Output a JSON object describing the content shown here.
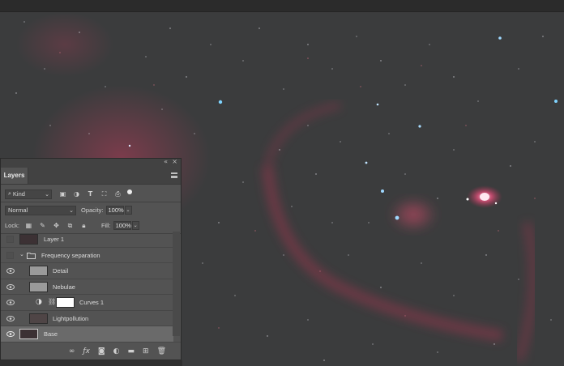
{
  "panel": {
    "collapse_glyph": "«",
    "close_glyph": "×",
    "tab_label": "Layers"
  },
  "filter": {
    "kind_label": "Kind",
    "icons": [
      "image-filter-icon",
      "adjustment-filter-icon",
      "type-filter-icon",
      "shape-filter-icon",
      "smart-object-filter-icon"
    ]
  },
  "blend": {
    "mode": "Normal",
    "opacity_label": "Opacity:",
    "opacity_value": "100%"
  },
  "lock": {
    "label": "Lock:",
    "fill_label": "Fill:",
    "fill_value": "100%"
  },
  "layers": [
    {
      "name": "Layer 1",
      "visible": false,
      "thumb": "stars"
    },
    {
      "name": "Frequency separation",
      "visible": false,
      "thumb": "folder"
    },
    {
      "name": "Detail",
      "visible": true,
      "thumb": "gray"
    },
    {
      "name": "Nebulae",
      "visible": true,
      "thumb": "gray"
    },
    {
      "name": "Curves 1",
      "visible": true,
      "thumb": "white"
    },
    {
      "name": "Lightpollution",
      "visible": true,
      "thumb": "dark"
    },
    {
      "name": "Base",
      "visible": true,
      "thumb": "stars",
      "selected": true
    }
  ],
  "colors": {
    "panel_bg": "#535353",
    "selected_row": "#6a6a6a",
    "nebula_red": "#b43c5a"
  }
}
